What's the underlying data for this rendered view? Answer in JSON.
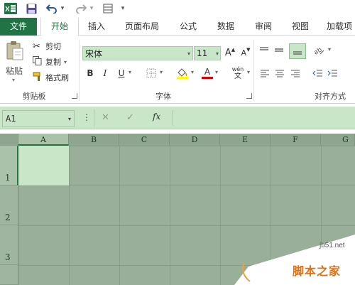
{
  "quick_access": {
    "app_icon_label": "X",
    "undo_arrow": "▾",
    "redo_arrow": "▾",
    "customize_arrow": "▾"
  },
  "tabs": [
    {
      "label": "文件"
    },
    {
      "label": "开始"
    },
    {
      "label": "插入"
    },
    {
      "label": "页面布局"
    },
    {
      "label": "公式"
    },
    {
      "label": "数据"
    },
    {
      "label": "审阅"
    },
    {
      "label": "视图"
    },
    {
      "label": "加载项"
    }
  ],
  "clipboard": {
    "paste": "粘贴",
    "cut": "剪切",
    "copy": "复制",
    "format_painter": "格式刷",
    "group_label": "剪贴板"
  },
  "font": {
    "name": "宋体",
    "size": "11",
    "bold": "B",
    "italic": "I",
    "underline": "U",
    "color_letter": "A",
    "phonetic_top": "wén",
    "phonetic_bottom": "文",
    "grow": "A",
    "shrink": "A",
    "group_label": "字体"
  },
  "alignment": {
    "group_label": "对齐方式"
  },
  "formula_bar": {
    "name_box": "A1",
    "fx": "fx",
    "cancel": "✕",
    "enter": "✓"
  },
  "columns": [
    "A",
    "B",
    "C",
    "D",
    "E",
    "F",
    "G"
  ],
  "rows": [
    "1",
    "2",
    "3"
  ],
  "watermark": {
    "url": "jb51.net",
    "site": "脚本之家"
  },
  "colors": {
    "excel_green": "#217346",
    "grid": "#9aaf9a",
    "selected_cell": "#c9e6c9"
  }
}
